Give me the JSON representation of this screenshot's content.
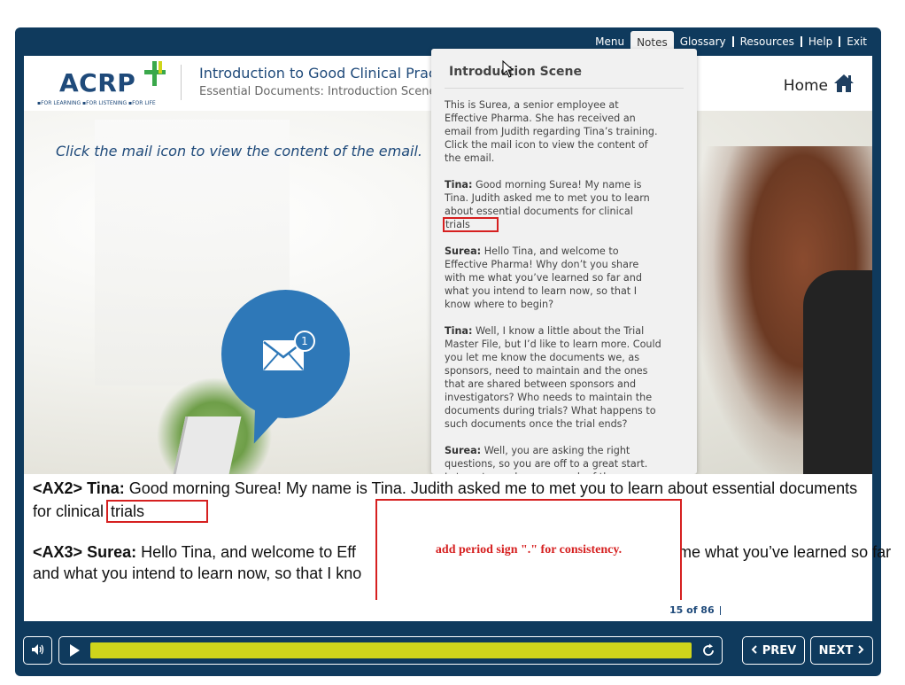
{
  "topnav": {
    "items": [
      {
        "label": "Menu"
      },
      {
        "label": "Notes"
      },
      {
        "label": "Glossary"
      },
      {
        "label": "Resources"
      },
      {
        "label": "Help"
      },
      {
        "label": "Exit"
      }
    ]
  },
  "header": {
    "logo_text": "ACRP",
    "logo_tagline": "▪FOR LEARNING ▪FOR LISTENING ▪FOR LIFE",
    "course_title": "Introduction to Good Clinical Pract",
    "course_subtitle": "Essential Documents: Introduction Scene",
    "home_label": "Home"
  },
  "scene": {
    "instruction": "Click the mail icon to view the content of the email.",
    "mail_badge": "1"
  },
  "notes_panel": {
    "title": "Introduction Scene",
    "intro": "This is Surea, a senior employee at Effective Pharma. She has received an email from Judith regarding Tina’s training. Click the mail icon to view the content of the email.",
    "entries": [
      {
        "speaker": "Tina:",
        "text": "Good morning Surea! My name is Tina. Judith asked me to met you to learn about essential documents for clinical",
        "tail": "trials"
      },
      {
        "speaker": "Surea:",
        "text": "Hello Tina, and welcome to Effective Pharma! Why don’t you share with me what you’ve learned so far and what you intend to learn now, so that I know where to begin?",
        "tail": ""
      },
      {
        "speaker": "Tina:",
        "text": "Well, I know a little about the Trial Master File, but I’d like to learn more. Could you let me know the documents we, as sponsors, need to maintain and the ones that are shared between sponsors and investigators? Who needs to maintain the documents during trials? What happens to such documents once the trial ends?",
        "tail": ""
      },
      {
        "speaker": "Surea:",
        "text": "Well, you are asking the right questions, so you are off to a great start. Let me try and answer each of these questions individually.",
        "tail": ""
      }
    ]
  },
  "transcript": {
    "line1_tag": "<AX2>",
    "line1_speaker": "Tina:",
    "line1_text": "Good morning Surea! My name is Tina. Judith asked me to met you to learn about essential documents",
    "line2_text": "for clinical",
    "line2_highlight": "trials",
    "line3_tag": "<AX3>",
    "line3_speaker": "Surea:",
    "line3_text_a": "Hello Tina, and welcome to Eff",
    "line3_text_b": "me what you’ve learned so far",
    "line4_text": "and what you intend to learn now, so that I kno"
  },
  "comment": {
    "text": "add period sign \".\" for consistency."
  },
  "footer": {
    "page_count": "15 of 86",
    "prev_label": "PREV",
    "next_label": "NEXT",
    "progress_percent": 97
  },
  "colors": {
    "frame": "#0f3a5d",
    "brand_blue": "#1f4a7a",
    "mail_blue": "#2e78b8",
    "progress": "#cfd51b",
    "annotation_red": "#d62020"
  }
}
